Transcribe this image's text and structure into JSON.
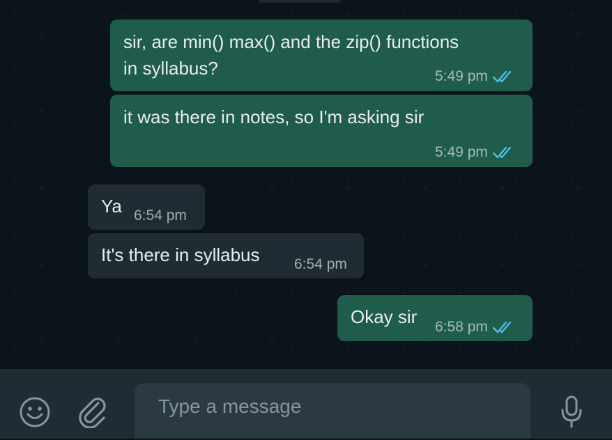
{
  "messages": [
    {
      "direction": "outgoing",
      "lines": [
        "sir, are min() max() and the zip() functions",
        "in syllabus?"
      ],
      "time": "5:49 pm",
      "status": "read-double-tick-icon"
    },
    {
      "direction": "outgoing",
      "lines": [
        "it was there in notes, so I'm asking sir"
      ],
      "time": "5:49 pm",
      "status": "read-double-tick-icon"
    },
    {
      "direction": "incoming",
      "lines": [
        "Ya"
      ],
      "time": "6:54 pm"
    },
    {
      "direction": "incoming",
      "lines": [
        "It's there in syllabus"
      ],
      "time": "6:54 pm"
    },
    {
      "direction": "outgoing",
      "lines": [
        "Okay sir"
      ],
      "time": "6:58 pm",
      "status": "read-double-tick-icon"
    }
  ],
  "composer": {
    "placeholder": "Type a message",
    "value": ""
  },
  "icons": {
    "emoji": "emoji-icon",
    "attach": "attach-paperclip-icon",
    "mic": "microphone-icon"
  },
  "colors": {
    "background": "#0b141a",
    "outgoing_bubble": "#1f5c4b",
    "incoming_bubble": "#202c33",
    "read_tick": "#53bdeb",
    "input_bar": "#1f2c34",
    "composer_field": "#2a3942"
  }
}
